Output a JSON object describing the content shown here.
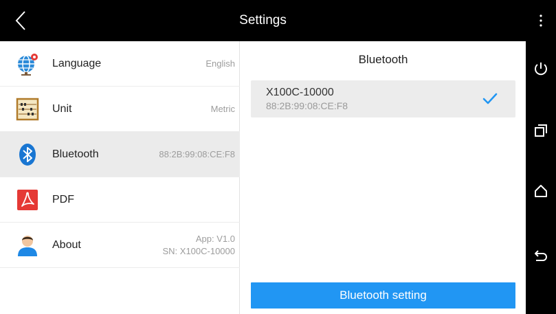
{
  "header": {
    "title": "Settings"
  },
  "sidebar": {
    "items": [
      {
        "label": "Language",
        "value": "English",
        "icon": "globe-icon"
      },
      {
        "label": "Unit",
        "value": "Metric",
        "icon": "abacus-icon"
      },
      {
        "label": "Bluetooth",
        "value": "88:2B:99:08:CE:F8",
        "icon": "bluetooth-icon"
      },
      {
        "label": "PDF",
        "value": "",
        "icon": "pdf-icon"
      },
      {
        "label": "About",
        "value_line1": "App: V1.0",
        "value_line2": "SN: X100C-10000",
        "icon": "person-icon"
      }
    ]
  },
  "main": {
    "title": "Bluetooth",
    "device": {
      "name": "X100C-10000",
      "mac": "88:2B:99:08:CE:F8",
      "connected": true
    },
    "setting_button": "Bluetooth setting"
  },
  "colors": {
    "accent": "#2196f3",
    "active_row": "#ebebeb",
    "bluetooth_icon": "#1976d2",
    "pdf_icon": "#e53935"
  }
}
